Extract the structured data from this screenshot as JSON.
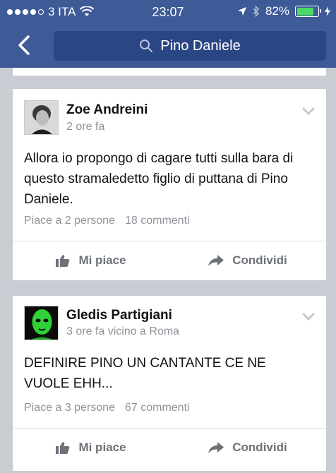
{
  "status_bar": {
    "carrier": "3 ITA",
    "time": "23:07",
    "battery": "82%",
    "battery_level": 0.82,
    "signal_bars_filled": 4,
    "signal_bars_total": 5
  },
  "search": {
    "query": "Pino Daniele"
  },
  "posts": [
    {
      "author": "Zoe Andreini",
      "meta": "2 ore fa",
      "text": "Allora io propongo di cagare tutti sulla bara di questo stramaledetto figlio di puttana di Pino Daniele.",
      "likes": "Piace a 2 persone",
      "comments": "18 commenti",
      "like_label": "Mi piace",
      "share_label": "Condividi"
    },
    {
      "author": "Gledis Partigiani",
      "meta": "3 ore fa vicino a Roma",
      "text": "DEFINIRE PINO UN CANTANTE CE NE VUOLE EHH...",
      "likes": "Piace a 3 persone",
      "comments": "67 commenti",
      "like_label": "Mi piace",
      "share_label": "Condividi"
    }
  ],
  "colors": {
    "nav_bar": "#3e5b98",
    "search_field": "#2a4684",
    "feed_background": "#c9ccd3",
    "battery_fill": "#4cd964"
  }
}
